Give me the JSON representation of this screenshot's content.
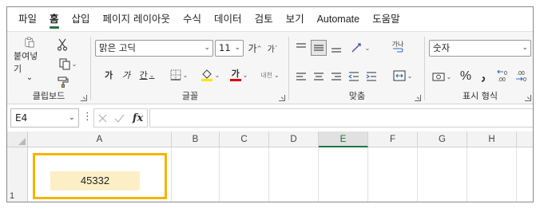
{
  "menu": {
    "tabs": [
      "파일",
      "홈",
      "삽입",
      "페이지 레이아웃",
      "수식",
      "데이터",
      "검토",
      "보기",
      "Automate",
      "도움말"
    ],
    "active_tab": "홈"
  },
  "ribbon": {
    "clipboard": {
      "label": "클립보드",
      "paste_label": "붙여넣기",
      "paste_caret": "⌄"
    },
    "font": {
      "label": "글꼴",
      "font_name": "맑은 고딕",
      "font_size": "11",
      "grow_font": "가",
      "shrink_font": "가",
      "bold": "가",
      "italic": "가",
      "underline": "간",
      "font_color_glyph": "가",
      "phonetic_glyph": "내천"
    },
    "alignment": {
      "label": "맞춤",
      "wrap_glyph": "가나"
    },
    "number": {
      "label": "표시 형식",
      "format": "숫자",
      "percent": "%"
    }
  },
  "formula_bar": {
    "name_box": "E4",
    "fx_label": "fx",
    "formula": ""
  },
  "sheet": {
    "columns": [
      "A",
      "B",
      "C",
      "D",
      "E",
      "F",
      "G",
      "H"
    ],
    "selected_column": "E",
    "rows": [
      "1"
    ],
    "cell_value": "45332"
  },
  "colors": {
    "accent": "#217346",
    "highlight_border": "#f4b400",
    "value_fill": "#fcefc6",
    "font_color_bar": "#e00000",
    "fill_color_bar": "#ffe600"
  }
}
